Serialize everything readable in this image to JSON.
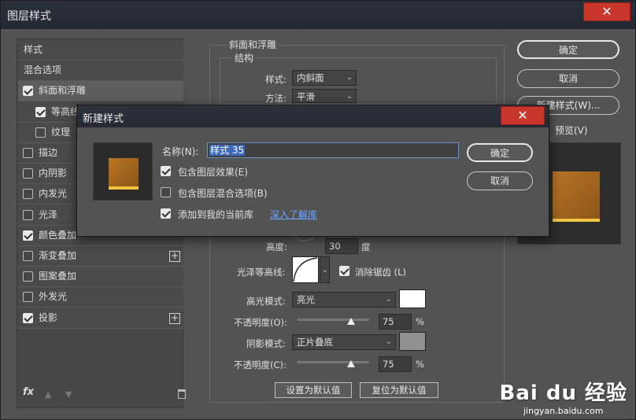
{
  "window": {
    "title": "图层样式"
  },
  "left_panel": {
    "items": [
      {
        "label": "样式",
        "checkbox": false,
        "checked": false,
        "plus": false
      },
      {
        "label": "混合选项",
        "checkbox": false,
        "checked": false,
        "plus": false
      },
      {
        "label": "斜面和浮雕",
        "checkbox": true,
        "checked": true,
        "plus": false,
        "selected": true
      },
      {
        "label": "等高线",
        "checkbox": true,
        "checked": true,
        "plus": false,
        "indent": true
      },
      {
        "label": "纹理",
        "checkbox": true,
        "checked": false,
        "plus": false,
        "indent": true
      },
      {
        "label": "描边",
        "checkbox": true,
        "checked": false,
        "plus": false
      },
      {
        "label": "内阴影",
        "checkbox": true,
        "checked": false,
        "plus": false
      },
      {
        "label": "内发光",
        "checkbox": true,
        "checked": false,
        "plus": false
      },
      {
        "label": "光泽",
        "checkbox": true,
        "checked": false,
        "plus": false
      },
      {
        "label": "颜色叠加",
        "checkbox": true,
        "checked": true,
        "plus": false
      },
      {
        "label": "渐变叠加",
        "checkbox": true,
        "checked": false,
        "plus": true
      },
      {
        "label": "图案叠加",
        "checkbox": true,
        "checked": false,
        "plus": false
      },
      {
        "label": "外发光",
        "checkbox": true,
        "checked": false,
        "plus": false
      },
      {
        "label": "投影",
        "checkbox": true,
        "checked": true,
        "plus": true
      }
    ],
    "fx_label": "fx"
  },
  "bevel": {
    "group_title": "斜面和浮雕",
    "structure_title": "结构",
    "style_label": "样式:",
    "style_value": "内斜面",
    "technique_label": "方法:",
    "technique_value": "平滑",
    "altitude_label": "高度:",
    "altitude_value": "30",
    "altitude_unit": "度",
    "gloss_contour_label": "光泽等高线:",
    "antialias_label": "消除锯齿 (L)",
    "antialias_checked": true,
    "highlight_mode_label": "高光模式:",
    "highlight_mode_value": "亮光",
    "highlight_color": "#ffffff",
    "highlight_opacity_label": "不透明度(O):",
    "highlight_opacity_value": "75",
    "highlight_opacity_fraction": 0.75,
    "shadow_mode_label": "阴影模式:",
    "shadow_mode_value": "正片叠底",
    "shadow_color": "#909090",
    "shadow_opacity_label": "不透明度(C):",
    "shadow_opacity_value": "75",
    "shadow_opacity_fraction": 0.75,
    "percent": "%",
    "set_default": "设置为默认值",
    "reset_default": "复位为默认值"
  },
  "right_panel": {
    "ok": "确定",
    "cancel": "取消",
    "new_style": "新建样式(W)...",
    "preview_label": "预览(V)",
    "preview_checked": true
  },
  "new_style_dialog": {
    "title": "新建样式",
    "name_label": "名称(N):",
    "name_value": "样式 35",
    "include_effects": "包含图层效果(E)",
    "include_effects_checked": true,
    "include_blending": "包含图层混合选项(B)",
    "include_blending_checked": false,
    "add_to_library": "添加到我的当前库",
    "add_to_library_checked": true,
    "learn_more": "深入了解库",
    "ok": "确定",
    "cancel": "取消"
  },
  "watermark": {
    "brand": "Bai du 经验",
    "url": "jingyan.baidu.com"
  },
  "colors": {
    "accent_fill": "#9a5f1c",
    "accent_edge": "#f2c241",
    "close_red": "#c8362c",
    "link": "#6ba6ff"
  }
}
